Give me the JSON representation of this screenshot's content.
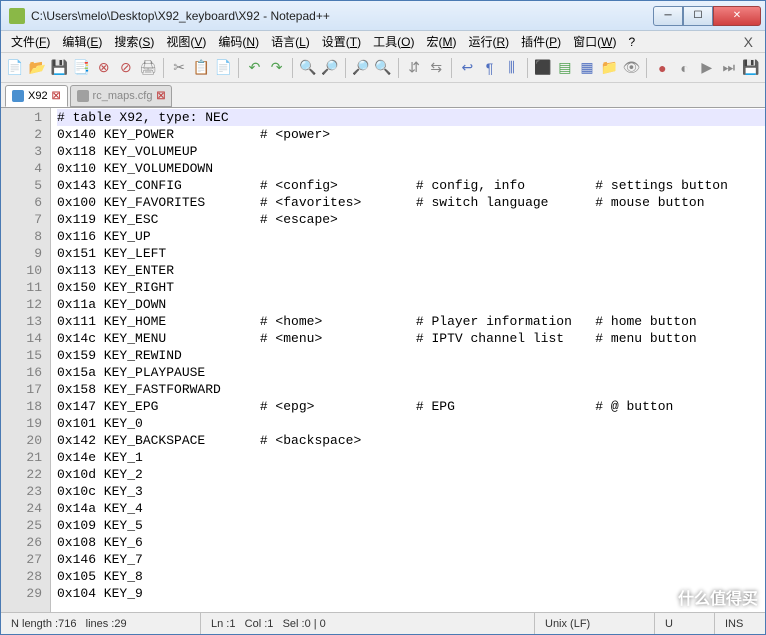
{
  "title": "C:\\Users\\melo\\Desktop\\X92_keyboard\\X92 - Notepad++",
  "win_controls": {
    "min": "─",
    "max": "☐",
    "close": "✕"
  },
  "menu": [
    {
      "label": "文件",
      "key": "F"
    },
    {
      "label": "编辑",
      "key": "E"
    },
    {
      "label": "搜索",
      "key": "S"
    },
    {
      "label": "视图",
      "key": "V"
    },
    {
      "label": "编码",
      "key": "N"
    },
    {
      "label": "语言",
      "key": "L"
    },
    {
      "label": "设置",
      "key": "T"
    },
    {
      "label": "工具",
      "key": "O"
    },
    {
      "label": "宏",
      "key": "M"
    },
    {
      "label": "运行",
      "key": "R"
    },
    {
      "label": "插件",
      "key": "P"
    },
    {
      "label": "窗口",
      "key": "W"
    },
    {
      "label": "?",
      "key": ""
    }
  ],
  "menu_close": "X",
  "toolbar_icons": [
    {
      "name": "new-icon",
      "glyph": "📄",
      "c": "#d8a050"
    },
    {
      "name": "open-icon",
      "glyph": "📂",
      "c": "#d8a050"
    },
    {
      "name": "save-icon",
      "glyph": "💾",
      "c": "#5070c0"
    },
    {
      "name": "save-all-icon",
      "glyph": "📑",
      "c": "#5070c0"
    },
    {
      "name": "close-file-icon",
      "glyph": "⊗",
      "c": "#c05050"
    },
    {
      "name": "close-all-icon",
      "glyph": "⊘",
      "c": "#c05050"
    },
    {
      "name": "print-icon",
      "glyph": "🖨",
      "c": "#888"
    },
    {
      "sep": true
    },
    {
      "name": "cut-icon",
      "glyph": "✂",
      "c": "#888"
    },
    {
      "name": "copy-icon",
      "glyph": "📋",
      "c": "#d8a050"
    },
    {
      "name": "paste-icon",
      "glyph": "📄",
      "c": "#d8a050"
    },
    {
      "sep": true
    },
    {
      "name": "undo-icon",
      "glyph": "↶",
      "c": "#50a050"
    },
    {
      "name": "redo-icon",
      "glyph": "↷",
      "c": "#50a050"
    },
    {
      "sep": true
    },
    {
      "name": "find-icon",
      "glyph": "🔍",
      "c": "#888"
    },
    {
      "name": "replace-icon",
      "glyph": "🔎",
      "c": "#888"
    },
    {
      "sep": true
    },
    {
      "name": "zoom-in-icon",
      "glyph": "🔎",
      "c": "#5070c0"
    },
    {
      "name": "zoom-out-icon",
      "glyph": "🔍",
      "c": "#5070c0"
    },
    {
      "sep": true
    },
    {
      "name": "sync-v-icon",
      "glyph": "⇵",
      "c": "#888"
    },
    {
      "name": "sync-h-icon",
      "glyph": "⇆",
      "c": "#888"
    },
    {
      "sep": true
    },
    {
      "name": "wrap-icon",
      "glyph": "↩",
      "c": "#5070c0"
    },
    {
      "name": "all-chars-icon",
      "glyph": "¶",
      "c": "#5070c0"
    },
    {
      "name": "indent-guide-icon",
      "glyph": "⫼",
      "c": "#5070c0"
    },
    {
      "sep": true
    },
    {
      "name": "lang-icon",
      "glyph": "⬛",
      "c": "#c05050"
    },
    {
      "name": "doc-map-icon",
      "glyph": "▤",
      "c": "#50a050"
    },
    {
      "name": "func-list-icon",
      "glyph": "▦",
      "c": "#5070c0"
    },
    {
      "name": "folder-icon",
      "glyph": "📁",
      "c": "#d8a050"
    },
    {
      "name": "monitor-icon",
      "glyph": "👁",
      "c": "#888"
    },
    {
      "sep": true
    },
    {
      "name": "record-icon",
      "glyph": "●",
      "c": "#c05050"
    },
    {
      "name": "stop-icon",
      "glyph": "◐",
      "c": "#888"
    },
    {
      "name": "play-icon",
      "glyph": "▶",
      "c": "#888"
    },
    {
      "name": "play-multi-icon",
      "glyph": "⏭",
      "c": "#888"
    },
    {
      "name": "save-macro-icon",
      "glyph": "💾",
      "c": "#888"
    }
  ],
  "tabs": [
    {
      "name": "X92",
      "active": true,
      "icon": "saved",
      "close": "☒"
    },
    {
      "name": "rc_maps.cfg",
      "active": false,
      "icon": "grey",
      "close": "☒"
    }
  ],
  "lines": [
    "# table X92, type: NEC",
    "0x140 KEY_POWER           # <power>",
    "0x118 KEY_VOLUMEUP",
    "0x110 KEY_VOLUMEDOWN",
    "0x143 KEY_CONFIG          # <config>          # config, info         # settings button",
    "0x100 KEY_FAVORITES       # <favorites>       # switch language      # mouse button",
    "0x119 KEY_ESC             # <escape>",
    "0x116 KEY_UP",
    "0x151 KEY_LEFT",
    "0x113 KEY_ENTER",
    "0x150 KEY_RIGHT",
    "0x11a KEY_DOWN",
    "0x111 KEY_HOME            # <home>            # Player information   # home button",
    "0x14c KEY_MENU            # <menu>            # IPTV channel list    # menu button",
    "0x159 KEY_REWIND",
    "0x15a KEY_PLAYPAUSE",
    "0x158 KEY_FASTFORWARD",
    "0x147 KEY_EPG             # <epg>             # EPG                  # @ button",
    "0x101 KEY_0",
    "0x142 KEY_BACKSPACE       # <backspace>",
    "0x14e KEY_1",
    "0x10d KEY_2",
    "0x10c KEY_3",
    "0x14a KEY_4",
    "0x109 KEY_5",
    "0x108 KEY_6",
    "0x146 KEY_7",
    "0x105 KEY_8",
    "0x104 KEY_9"
  ],
  "status": {
    "length_label": "N length : ",
    "length": "716",
    "lines_label": "lines : ",
    "lines": "29",
    "ln_label": "Ln : ",
    "ln": "1",
    "col_label": "Col : ",
    "col": "1",
    "sel_label": "Sel : ",
    "sel": "0 | 0",
    "eol": "Unix (LF)",
    "enc": "U",
    "ins": "INS"
  },
  "watermark": "什么值得买"
}
